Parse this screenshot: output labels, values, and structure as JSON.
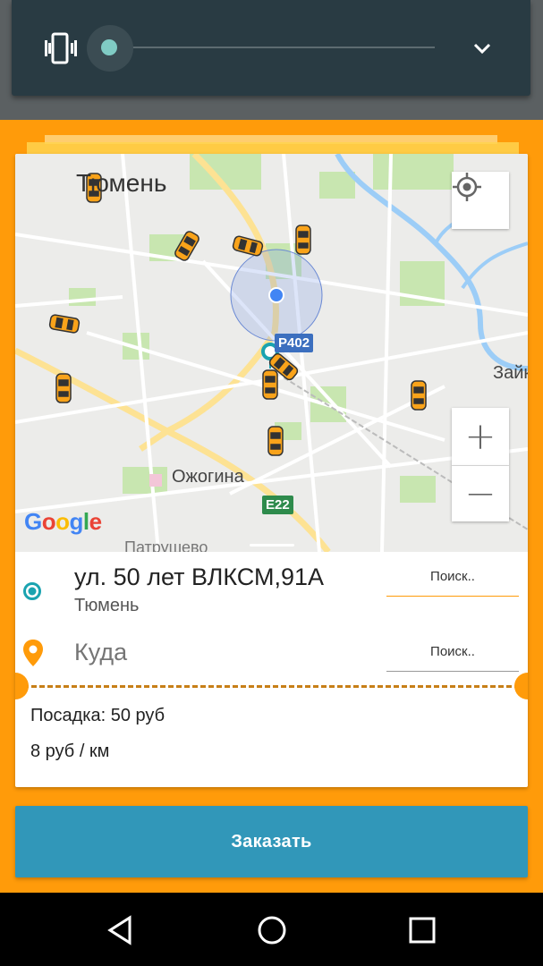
{
  "volume": {
    "level": 0.02
  },
  "map": {
    "city_label": "Тюмень",
    "district_label": "Ожогина",
    "east_label": "Зайк",
    "bottom_label": "Патрушево",
    "road_r402": "Р402",
    "road_e22": "E22",
    "brand": "Google",
    "zoom_in": "+",
    "zoom_out": "−"
  },
  "route": {
    "from": {
      "address": "ул. 50 лет ВЛКСМ,91А",
      "city": "Тюмень",
      "search_label": "Поиск.."
    },
    "to": {
      "placeholder": "Куда",
      "search_label": "Поиск.."
    }
  },
  "tariff": {
    "boarding": "Посадка: 50 руб",
    "per_km": "8 руб / км"
  },
  "order_button": "Заказать",
  "colors": {
    "accent": "#ff9b0a",
    "button": "#3197b9",
    "teal": "#1aa3b0"
  }
}
